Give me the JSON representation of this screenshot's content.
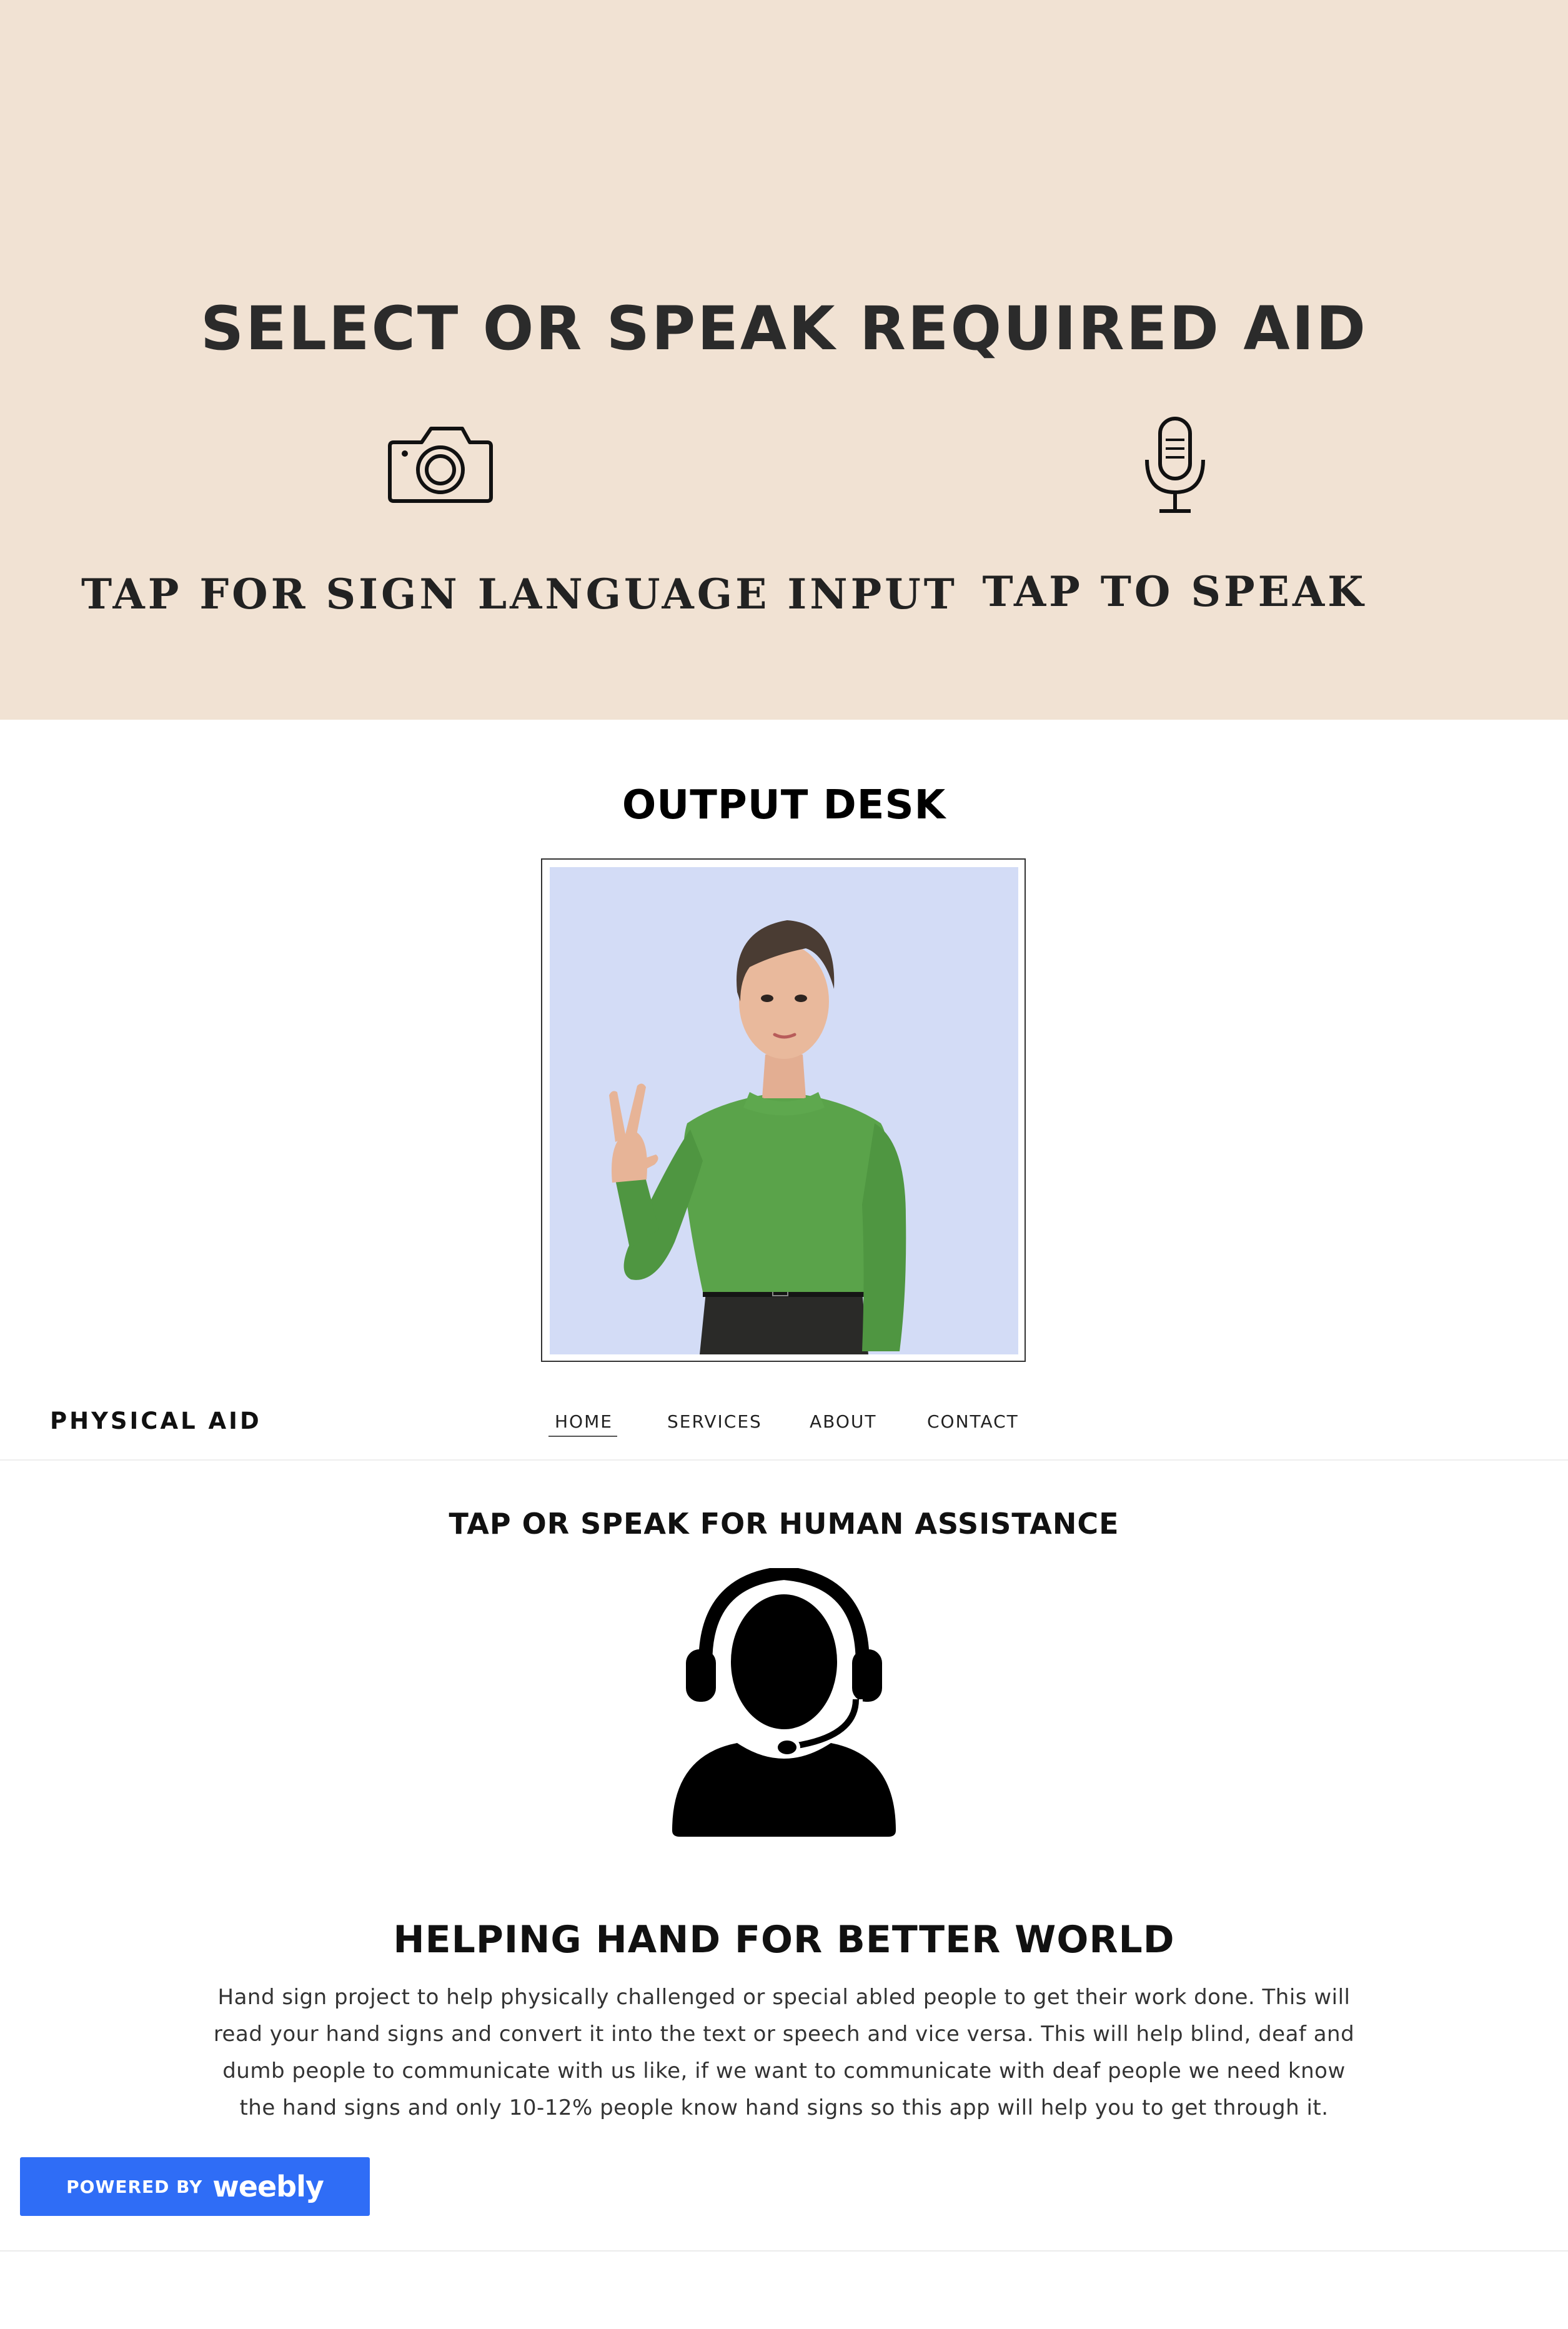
{
  "hero": {
    "title": "SELECT OR SPEAK REQUIRED AID",
    "sign_label": "TAP FOR SIGN LANGUAGE INPUT",
    "speak_label": "TAP TO SPEAK",
    "sign_icon": "camera-icon",
    "speak_icon": "microphone-icon",
    "background": "#f1e2d3"
  },
  "output": {
    "title": "OUTPUT DESK",
    "avatar_bg": "#d3dcf6",
    "shirt_color": "#5aa34a"
  },
  "nav": {
    "brand": "PHYSICAL AID",
    "items": [
      "HOME",
      "SERVICES",
      "ABOUT",
      "CONTACT"
    ],
    "active": "HOME"
  },
  "assist": {
    "title": "TAP OR SPEAK FOR HUMAN ASSISTANCE",
    "icon": "support-agent-icon"
  },
  "about": {
    "title": "HELPING HAND FOR BETTER WORLD",
    "body": "Hand sign project to help physically challenged or special abled people to get their work done. This will read your hand signs and convert it into the text or speech and vice versa. This will help blind, deaf and dumb people to communicate with us like, if we want to communicate with deaf people we need know the hand signs and only 10-12% people know hand signs so this app will help you to get through it."
  },
  "badge": {
    "powered_by": "POWERED BY",
    "brand": "weebly",
    "color": "#2f6df6"
  }
}
